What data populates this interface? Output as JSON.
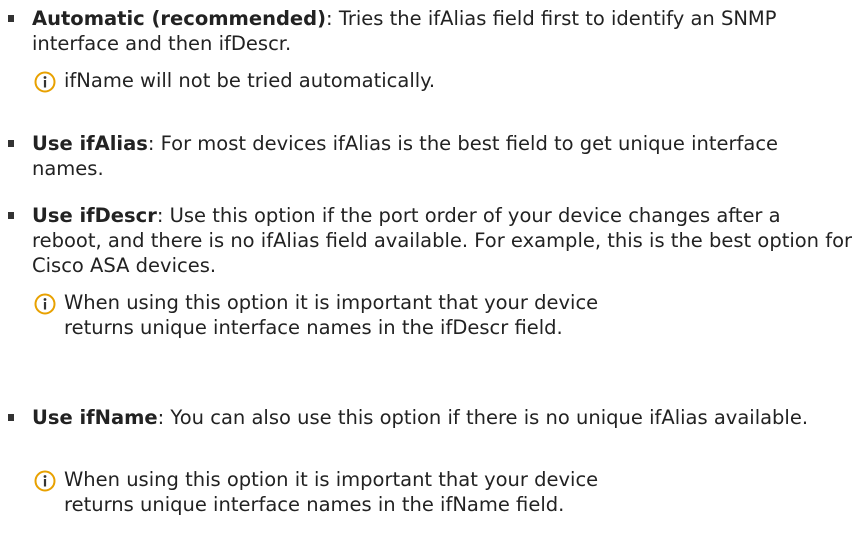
{
  "items": [
    {
      "term": "Automatic (recommended)",
      "description": ": Tries the ifAlias field first to identify an SNMP interface and then ifDescr.",
      "note": "ifName will not be tried automatically."
    },
    {
      "term": "Use ifAlias",
      "description": ": For most devices ifAlias is the best field to get unique interface names."
    },
    {
      "term": "Use ifDescr",
      "description": ": Use this option if the port order of your device changes after a reboot, and there is no ifAlias field available. For example, this is the best option for Cisco ASA devices.",
      "note": "When using this option it is important that your device returns unique interface names in the ifDescr field."
    },
    {
      "term": "Use ifName",
      "description": ": You can also use this option if there is no unique ifAlias available.",
      "note": "When using this option it is important that your device returns unique interface names in the ifName field."
    }
  ],
  "icons": {
    "note": "info-icon",
    "note_color": "#e8a100"
  }
}
